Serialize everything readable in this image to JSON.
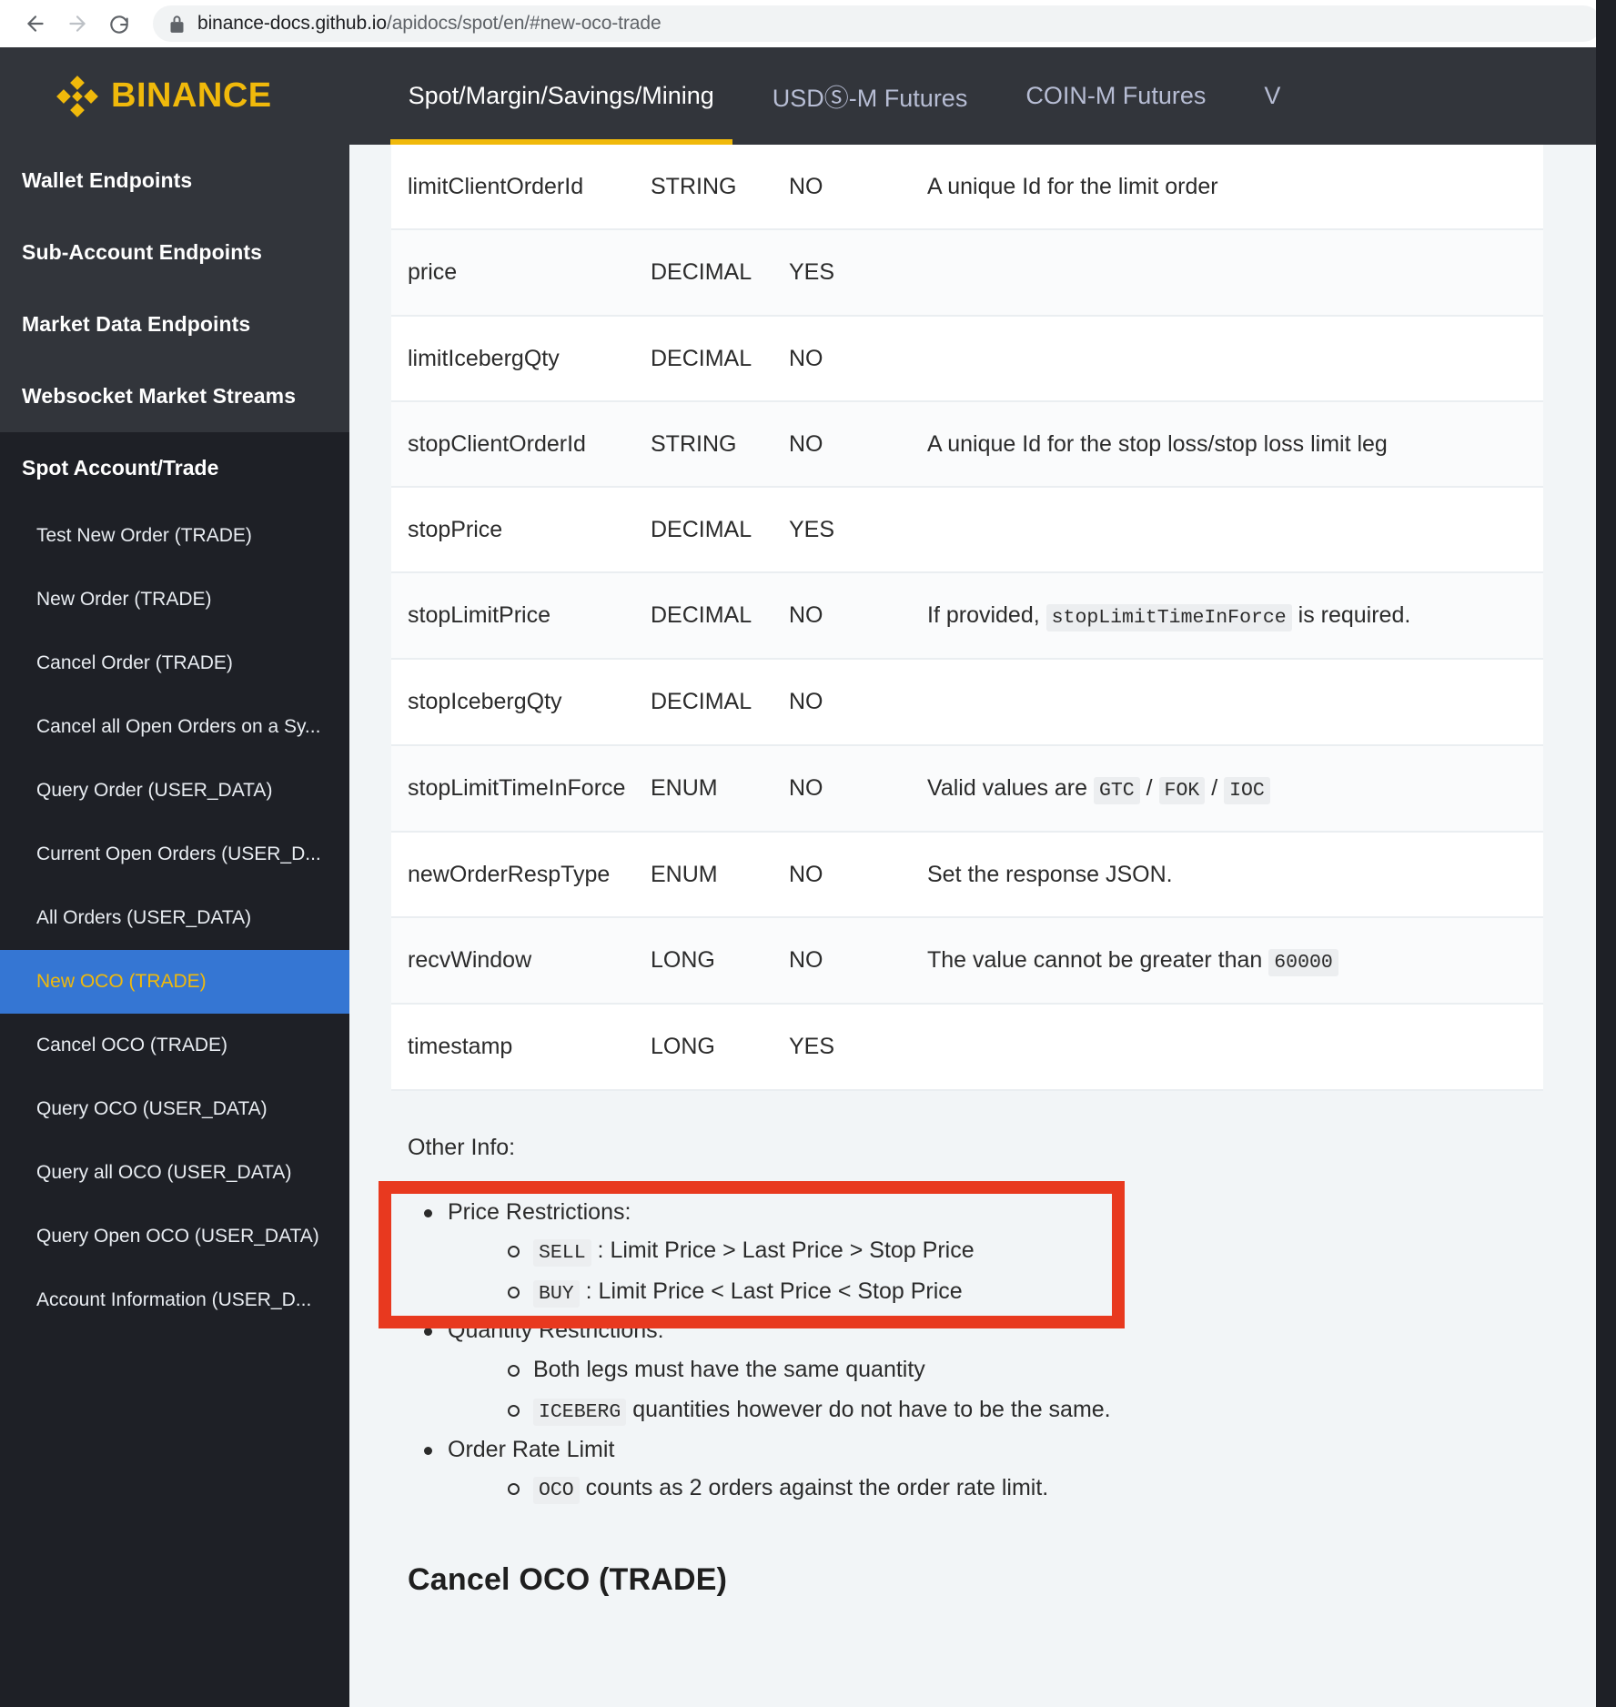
{
  "browser": {
    "back_label": "Back",
    "forward_label": "Forward",
    "reload_label": "Reload",
    "lock_icon": "lock-icon",
    "url_domain": "binance-docs.github.io",
    "url_path": "/apidocs/spot/en/#new-oco-trade"
  },
  "header": {
    "logo_text": "BINANCE",
    "nav": [
      {
        "label": "Spot/Margin/Savings/Mining",
        "active": true
      },
      {
        "label": "USDⓈ-M Futures",
        "active": false
      },
      {
        "label": "COIN-M Futures",
        "active": false
      },
      {
        "label": "V",
        "active": false
      }
    ]
  },
  "sidebar": {
    "top_items": [
      {
        "label": "Wallet Endpoints"
      },
      {
        "label": "Sub-Account Endpoints"
      },
      {
        "label": "Market Data Endpoints"
      },
      {
        "label": "Websocket Market Streams"
      }
    ],
    "group_title": "Spot Account/Trade",
    "sub_items": [
      {
        "label": "Test New Order (TRADE)",
        "selected": false
      },
      {
        "label": "New Order (TRADE)",
        "selected": false
      },
      {
        "label": "Cancel Order (TRADE)",
        "selected": false
      },
      {
        "label": "Cancel all Open Orders on a Sy...",
        "selected": false
      },
      {
        "label": "Query Order (USER_DATA)",
        "selected": false
      },
      {
        "label": "Current Open Orders (USER_D...",
        "selected": false
      },
      {
        "label": "All Orders (USER_DATA)",
        "selected": false
      },
      {
        "label": "New OCO (TRADE)",
        "selected": true
      },
      {
        "label": "Cancel OCO (TRADE)",
        "selected": false
      },
      {
        "label": "Query OCO (USER_DATA)",
        "selected": false
      },
      {
        "label": "Query all OCO (USER_DATA)",
        "selected": false
      },
      {
        "label": "Query Open OCO (USER_DATA)",
        "selected": false
      },
      {
        "label": "Account Information (USER_D...",
        "selected": false
      }
    ]
  },
  "main": {
    "params_table": {
      "rows": [
        {
          "name": "limitClientOrderId",
          "type": "STRING",
          "mandatory": "NO",
          "desc_parts": [
            {
              "t": "text",
              "v": "A unique Id for the limit order"
            }
          ]
        },
        {
          "name": "price",
          "type": "DECIMAL",
          "mandatory": "YES",
          "desc_parts": []
        },
        {
          "name": "limitIcebergQty",
          "type": "DECIMAL",
          "mandatory": "NO",
          "desc_parts": []
        },
        {
          "name": "stopClientOrderId",
          "type": "STRING",
          "mandatory": "NO",
          "desc_parts": [
            {
              "t": "text",
              "v": "A unique Id for the stop loss/stop loss limit leg"
            }
          ]
        },
        {
          "name": "stopPrice",
          "type": "DECIMAL",
          "mandatory": "YES",
          "desc_parts": []
        },
        {
          "name": "stopLimitPrice",
          "type": "DECIMAL",
          "mandatory": "NO",
          "desc_parts": [
            {
              "t": "text",
              "v": "If provided, "
            },
            {
              "t": "code",
              "v": "stopLimitTimeInForce"
            },
            {
              "t": "text",
              "v": " is required."
            }
          ]
        },
        {
          "name": "stopIcebergQty",
          "type": "DECIMAL",
          "mandatory": "NO",
          "desc_parts": []
        },
        {
          "name": "stopLimitTimeInForce",
          "type": "ENUM",
          "mandatory": "NO",
          "desc_parts": [
            {
              "t": "text",
              "v": "Valid values are "
            },
            {
              "t": "code",
              "v": "GTC"
            },
            {
              "t": "text",
              "v": " / "
            },
            {
              "t": "code",
              "v": "FOK"
            },
            {
              "t": "text",
              "v": " / "
            },
            {
              "t": "code",
              "v": "IOC"
            }
          ]
        },
        {
          "name": "newOrderRespType",
          "type": "ENUM",
          "mandatory": "NO",
          "desc_parts": [
            {
              "t": "text",
              "v": "Set the response JSON."
            }
          ]
        },
        {
          "name": "recvWindow",
          "type": "LONG",
          "mandatory": "NO",
          "desc_parts": [
            {
              "t": "text",
              "v": "The value cannot be greater than "
            },
            {
              "t": "code",
              "v": "60000"
            }
          ]
        },
        {
          "name": "timestamp",
          "type": "LONG",
          "mandatory": "YES",
          "desc_parts": []
        }
      ]
    },
    "other_info_label": "Other Info:",
    "info_list": [
      {
        "label_parts": [
          {
            "t": "text",
            "v": "Price Restrictions:"
          }
        ],
        "highlighted": true,
        "children": [
          {
            "parts": [
              {
                "t": "code",
                "v": "SELL"
              },
              {
                "t": "text",
                "v": " : Limit Price > Last Price > Stop Price"
              }
            ]
          },
          {
            "parts": [
              {
                "t": "code",
                "v": "BUY"
              },
              {
                "t": "text",
                "v": " : Limit Price < Last Price < Stop Price"
              }
            ]
          }
        ]
      },
      {
        "label_parts": [
          {
            "t": "text",
            "v": "Quantity Restrictions:"
          }
        ],
        "highlighted": false,
        "children": [
          {
            "parts": [
              {
                "t": "text",
                "v": "Both legs must have the same quantity"
              }
            ]
          },
          {
            "parts": [
              {
                "t": "code",
                "v": "ICEBERG"
              },
              {
                "t": "text",
                "v": " quantities however do not have to be the same."
              }
            ]
          }
        ]
      },
      {
        "label_parts": [
          {
            "t": "text",
            "v": "Order Rate Limit"
          }
        ],
        "highlighted": false,
        "children": [
          {
            "parts": [
              {
                "t": "code",
                "v": "OCO"
              },
              {
                "t": "text",
                "v": " counts as 2 orders against the order rate limit."
              }
            ]
          }
        ]
      }
    ],
    "section_title": "Cancel OCO (TRADE)"
  },
  "annotation": {
    "highlight_color": "#e8391f",
    "highlight_label": "price-restrictions-highlight"
  }
}
